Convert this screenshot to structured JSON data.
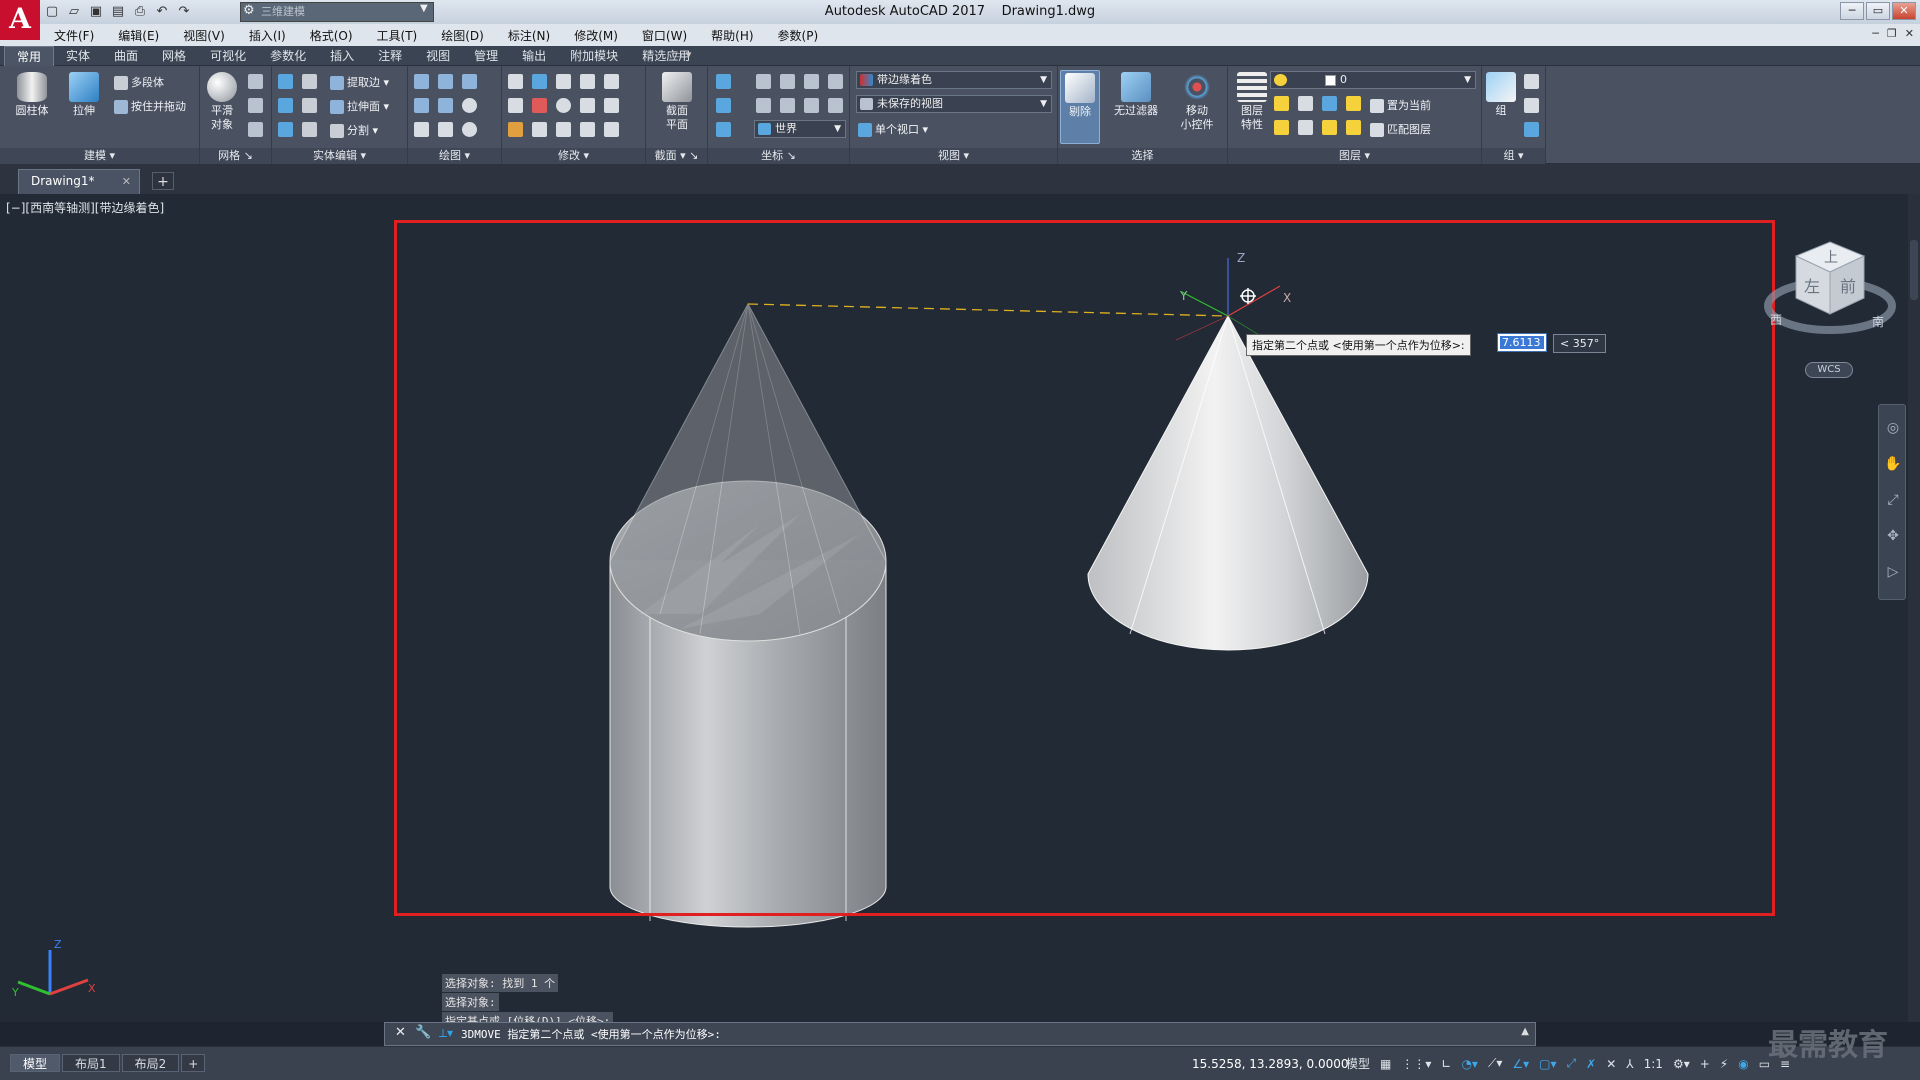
{
  "title": {
    "app": "Autodesk AutoCAD 2017",
    "file": "Drawing1.dwg"
  },
  "workspace": "三维建模",
  "menu": [
    "文件(F)",
    "编辑(E)",
    "视图(V)",
    "插入(I)",
    "格式(O)",
    "工具(T)",
    "绘图(D)",
    "标注(N)",
    "修改(M)",
    "窗口(W)",
    "帮助(H)",
    "参数(P)"
  ],
  "ribbon_tabs": [
    "常用",
    "实体",
    "曲面",
    "网格",
    "可视化",
    "参数化",
    "插入",
    "注释",
    "视图",
    "管理",
    "输出",
    "附加模块",
    "精选应用"
  ],
  "ribbon": {
    "modeling": {
      "title": "建模",
      "cylinder": "圆柱体",
      "extrude": "拉伸",
      "polysolid": "多段体",
      "presspull": "按住并拖动"
    },
    "mesh": {
      "title": "网格",
      "smooth": "平滑",
      "smooth2": "对象"
    },
    "solid_edit": {
      "title": "实体编辑",
      "extract_edges": "提取边",
      "extrude_faces": "拉伸面",
      "separate": "分割"
    },
    "draw": {
      "title": "绘图"
    },
    "modify": {
      "title": "修改"
    },
    "section": {
      "title": "截面",
      "plane": "截面",
      "plane2": "平面"
    },
    "coords": {
      "title": "坐标",
      "world": "世界"
    },
    "view": {
      "title": "视图",
      "visual_style": "带边缘着色",
      "named_view": "未保存的视图",
      "viewport": "单个视口"
    },
    "selection": {
      "title": "选择",
      "cull": "剔除",
      "no_filter": "无过滤器",
      "gizmo": "移动",
      "gizmo2": "小控件"
    },
    "layers": {
      "title": "图层",
      "layer_props": "图层",
      "layer_props2": "特性",
      "layer_name": "0",
      "set_current": "置为当前",
      "match_layer": "匹配图层"
    },
    "groups": {
      "title": "组",
      "group": "组"
    }
  },
  "doc_tab": "Drawing1*",
  "viewport_label": "[−][西南等轴测][带边缘着色]",
  "tooltip": "指定第二个点或 <使用第一个点作为位移>:",
  "dynamic_input": {
    "value": "7.6113",
    "angle": "< 357°"
  },
  "viewcube": {
    "top": "上",
    "left": "左",
    "front": "前",
    "west": "西",
    "south": "南"
  },
  "wcs": "WCS",
  "gizmo_labels": {
    "x": "X",
    "y": "Y",
    "z": "Z"
  },
  "command_history": [
    "选择对象: 找到 1 个",
    "选择对象:",
    "指定基点或 [位移(D)] <位移>:"
  ],
  "command_line": "3DMOVE 指定第二个点或 <使用第一个点作为位移>:",
  "layout_tabs": [
    "模型",
    "布局1",
    "布局2"
  ],
  "status": {
    "coords": "15.5258, 13.2893, 0.0000",
    "model": "模型",
    "scale": "1:1"
  },
  "watermark": "最需教育",
  "colors": {
    "highlight": "#e02020",
    "accent": "#3ea7ea",
    "app_red": "#c8102e"
  }
}
